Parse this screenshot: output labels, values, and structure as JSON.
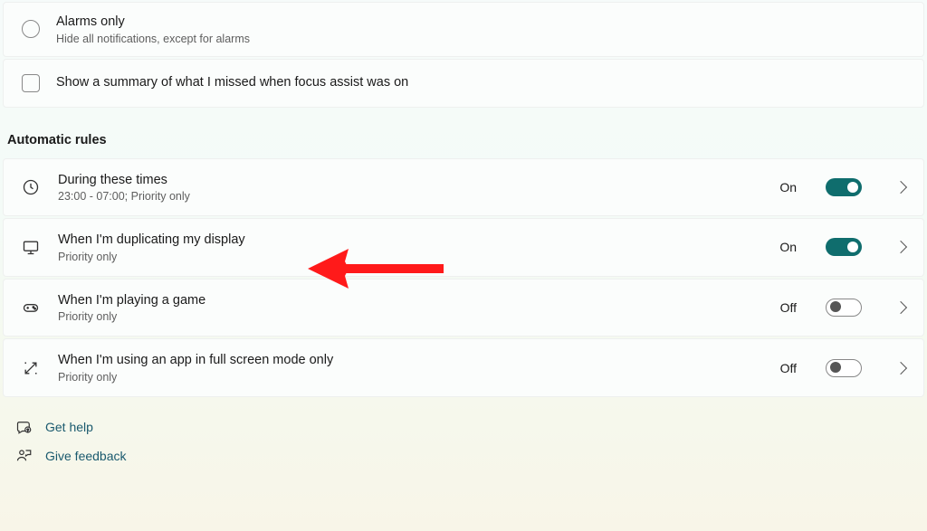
{
  "alarms": {
    "title": "Alarms only",
    "desc": "Hide all notifications, except for alarms"
  },
  "summary": {
    "label": "Show a summary of what I missed when focus assist was on"
  },
  "section": "Automatic rules",
  "rules": [
    {
      "title": "During these times",
      "desc": "23:00 - 07:00; Priority only",
      "state": "On",
      "on": true
    },
    {
      "title": "When I'm duplicating my display",
      "desc": "Priority only",
      "state": "On",
      "on": true
    },
    {
      "title": "When I'm playing a game",
      "desc": "Priority only",
      "state": "Off",
      "on": false
    },
    {
      "title": "When I'm using an app in full screen mode only",
      "desc": "Priority only",
      "state": "Off",
      "on": false
    }
  ],
  "footer": {
    "help": "Get help",
    "feedback": "Give feedback"
  }
}
